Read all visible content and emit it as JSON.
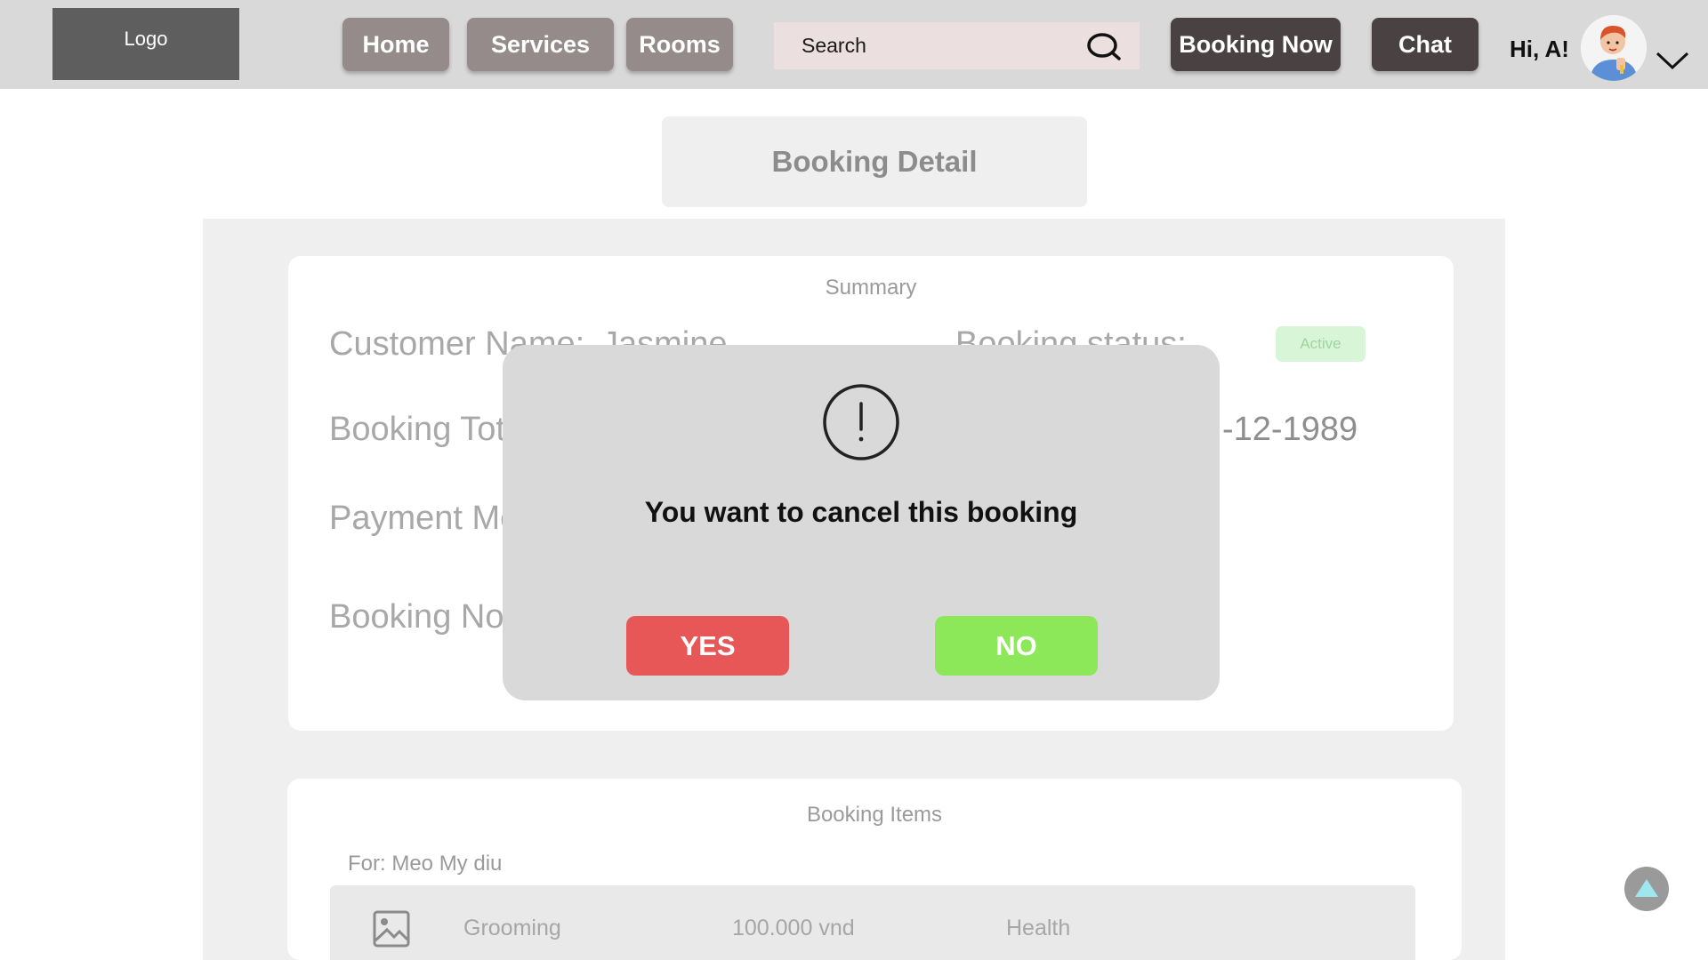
{
  "header": {
    "logo": "Logo",
    "nav": [
      "Home",
      "Services",
      "Rooms"
    ],
    "search_placeholder": "Search",
    "booking_now": "Booking Now",
    "chat": "Chat",
    "greeting": "Hi, A!"
  },
  "page": {
    "title": "Booking Detail"
  },
  "summary": {
    "title": "Summary",
    "customer_label": "Customer Name:",
    "customer_value": "Jasmine",
    "status_label": "Booking status:",
    "status_badge": "Active",
    "total_label": "Booking Total",
    "date_value": "-12-1989",
    "payment_label": "Payment Method",
    "note_label": "Booking Note"
  },
  "booking_items": {
    "title": "Booking Items",
    "for_label": "For: Meo My diu",
    "rows": [
      {
        "name": "Grooming",
        "price": "100.000 vnd",
        "category": "Health"
      }
    ]
  },
  "modal": {
    "message": "You want to cancel this booking",
    "yes": "YES",
    "no": "NO"
  },
  "colors": {
    "header_bg": "#d9d9d9",
    "nav_button": "#968b8b",
    "dark_button": "#4a4242",
    "yes_button": "#e85757",
    "no_button": "#8ce858",
    "badge_bg": "#d8f5d8"
  },
  "icons": {
    "search": "search-icon",
    "chevron": "chevron-down-icon",
    "alert": "alert-circle-icon",
    "image": "image-icon",
    "scroll_top": "arrow-up-icon"
  }
}
